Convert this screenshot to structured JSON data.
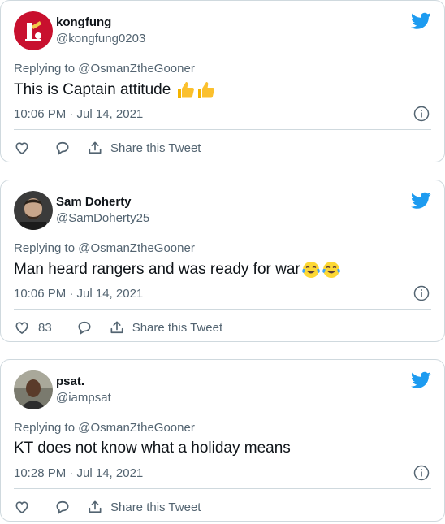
{
  "tweets": [
    {
      "name": "kongfung",
      "handle": "@kongfung0203",
      "replying_to": "Replying to @OsmanZtheGooner",
      "text": "This is Captain attitude",
      "emojis": [
        "thumbs-up",
        "thumbs-up"
      ],
      "timestamp": "10:06 PM · Jul 14, 2021",
      "like_count": "",
      "share_label": "Share this Tweet"
    },
    {
      "name": "Sam Doherty",
      "handle": "@SamDoherty25",
      "replying_to": "Replying to @OsmanZtheGooner",
      "text": "Man heard rangers and was ready for war",
      "emojis": [
        "tears-of-joy",
        "tears-of-joy"
      ],
      "timestamp": "10:06 PM · Jul 14, 2021",
      "like_count": "83",
      "share_label": "Share this Tweet"
    },
    {
      "name": "psat.",
      "handle": "@iampsat",
      "replying_to": "Replying to @OsmanZtheGooner",
      "text": "KT does not know what a holiday means",
      "emojis": [],
      "timestamp": "10:28 PM · Jul 14, 2021",
      "like_count": "",
      "share_label": "Share this Tweet"
    }
  ],
  "colors": {
    "twitter_blue": "#1d9bf0",
    "secondary_text": "#536471",
    "border": "#cfd9de"
  }
}
